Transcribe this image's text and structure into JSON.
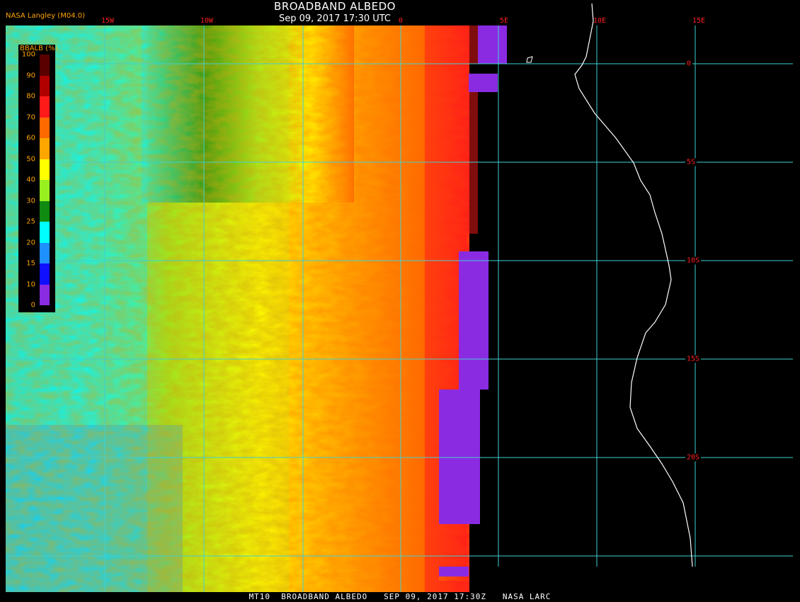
{
  "header": {
    "title": "BROADBAND ALBEDO",
    "subtitle": "Sep 09, 2017 17:30 UTC",
    "source": "NASA Langley (M04.0)"
  },
  "footer": {
    "banner": "MT10  BROADBAND ALBEDO   SEP 09, 2017 17:30Z   NASA LARC"
  },
  "map": {
    "longitude_labels": [
      "15W",
      "10W",
      "0",
      "5E",
      "10E",
      "15E"
    ],
    "latitude_labels": [
      "0",
      "5S",
      "10S",
      "15S",
      "20S"
    ],
    "grid_color": "#40d0d0",
    "coastline_color": "#ffffff",
    "background_color": "#000000"
  },
  "legend": {
    "title": "BBALB (%)",
    "ticks": [
      "100",
      "90",
      "80",
      "70",
      "60",
      "50",
      "40",
      "30",
      "25",
      "20",
      "15",
      "10",
      "0"
    ],
    "colors": [
      "#5a0000",
      "#b00000",
      "#ff1a1a",
      "#ff6a00",
      "#ffa500",
      "#ffff00",
      "#98f020",
      "#108a10",
      "#00ffff",
      "#1e90ff",
      "#1010ff",
      "#8a2be2"
    ]
  }
}
